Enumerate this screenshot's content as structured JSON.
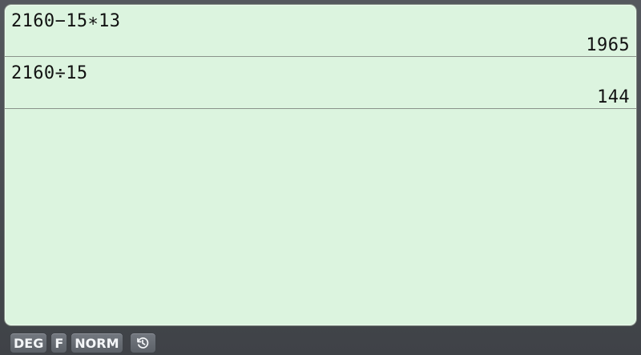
{
  "history": [
    {
      "expression": "2160−15∗13",
      "result": "1965"
    },
    {
      "expression": "2160÷15",
      "result": "144"
    }
  ],
  "status_bar": {
    "angle_mode": "DEG",
    "format_mode": "F",
    "number_mode": "NORM",
    "history_icon": "history-icon"
  },
  "colors": {
    "display_background": "#dcf4df",
    "status_bar_background": "#4a4d53"
  }
}
